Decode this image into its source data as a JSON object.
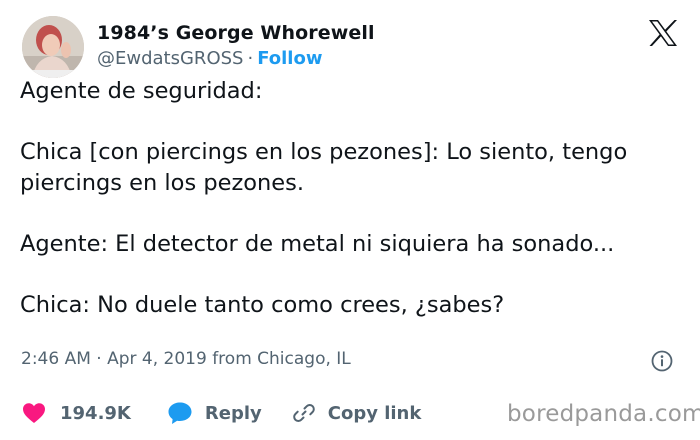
{
  "author": {
    "display_name": "1984’s George Whorewell",
    "handle": "@EwdatsGROSS",
    "separator": "·",
    "follow_label": "Follow"
  },
  "tweet": {
    "lines": [
      "Agente de seguridad:",
      "",
      "Chica [con piercings en los pezones]: Lo siento, tengo",
      "piercings en los pezones.",
      "",
      "Agente: El detector de metal ni siquiera ha sonado...",
      "",
      "Chica: No duele tanto como crees, ¿sabes?"
    ],
    "timestamp": "2:46 AM · Apr 4, 2019 from Chicago, IL"
  },
  "actions": {
    "likes": "194.9K",
    "reply_label": "Reply",
    "copy_label": "Copy link"
  },
  "watermark": "boredpanda.com",
  "icons": {
    "logo": "x-logo-icon",
    "info": "info-icon",
    "like": "heart-icon",
    "reply": "speech-bubble-icon",
    "copy": "link-icon"
  },
  "colors": {
    "accent": "#1d9bf0",
    "like": "#f91880",
    "text": "#0f1419",
    "secondary": "#536471"
  }
}
